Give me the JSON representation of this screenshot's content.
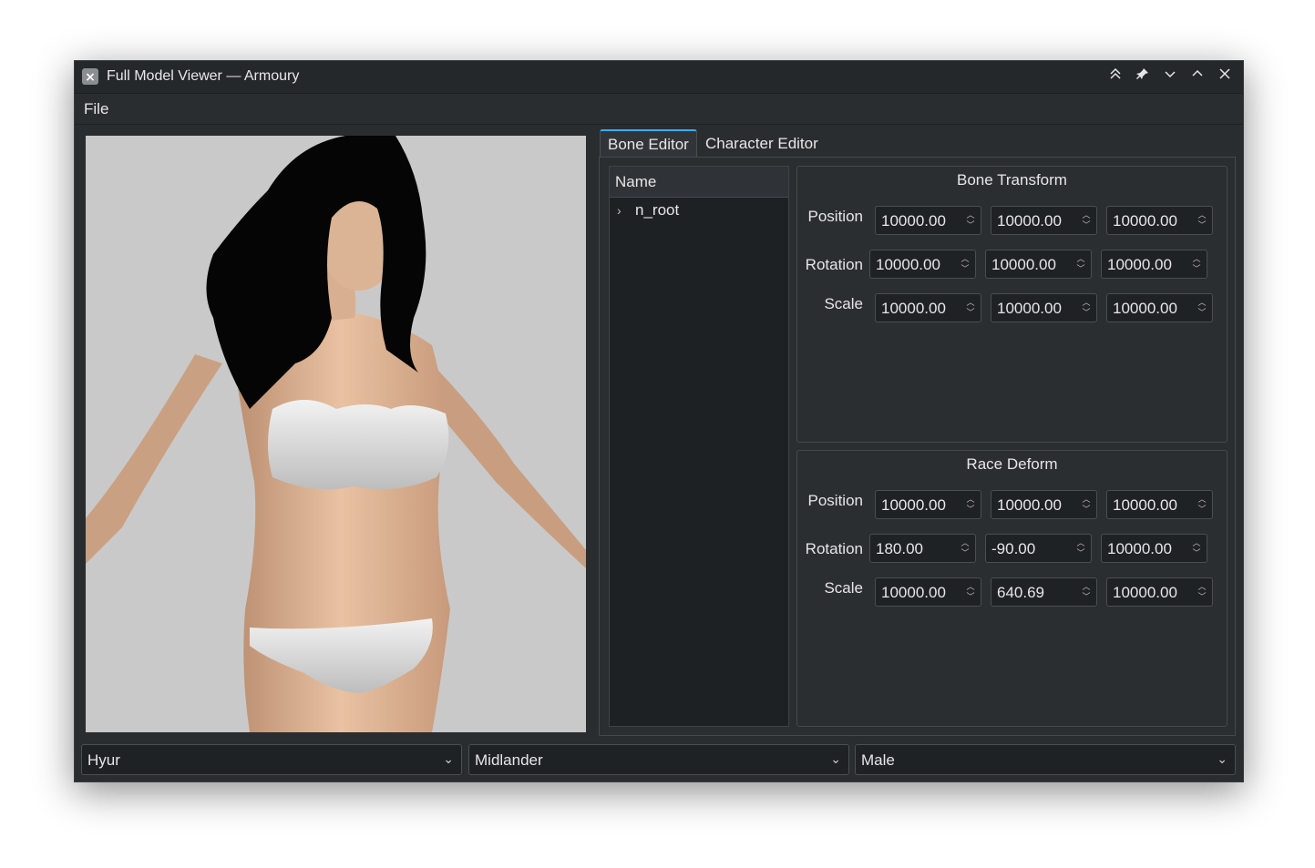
{
  "window": {
    "title": "Full Model Viewer — Armoury",
    "app_icon": "app-logo-icon",
    "buttons": {
      "keep_above": "⌃⌃",
      "pin": "📌",
      "minimize": "⌄",
      "maximize": "⌃",
      "close": "✕"
    }
  },
  "menu": {
    "file": "File"
  },
  "tabs": [
    {
      "label": "Bone Editor",
      "active": true
    },
    {
      "label": "Character Editor",
      "active": false
    }
  ],
  "tree": {
    "header": "Name",
    "items": [
      {
        "label": "n_root",
        "expandable": true
      }
    ]
  },
  "bone_transform": {
    "title": "Bone Transform",
    "rows": [
      {
        "label": "Position",
        "values": [
          "10000.00",
          "10000.00",
          "10000.00"
        ]
      },
      {
        "label": "Rotation",
        "values": [
          "10000.00",
          "10000.00",
          "10000.00"
        ]
      },
      {
        "label": "Scale",
        "values": [
          "10000.00",
          "10000.00",
          "10000.00"
        ]
      }
    ]
  },
  "race_deform": {
    "title": "Race Deform",
    "rows": [
      {
        "label": "Position",
        "values": [
          "10000.00",
          "10000.00",
          "10000.00"
        ]
      },
      {
        "label": "Rotation",
        "values": [
          "180.00",
          "-90.00",
          "10000.00"
        ]
      },
      {
        "label": "Scale",
        "values": [
          "10000.00",
          "640.69",
          "10000.00"
        ]
      }
    ]
  },
  "selectors": {
    "race": "Hyur",
    "subrace": "Midlander",
    "gender": "Male"
  },
  "colors": {
    "accent": "#3daee9",
    "window_bg": "#2a2d30",
    "viewport_bg": "#c9c9c9"
  }
}
